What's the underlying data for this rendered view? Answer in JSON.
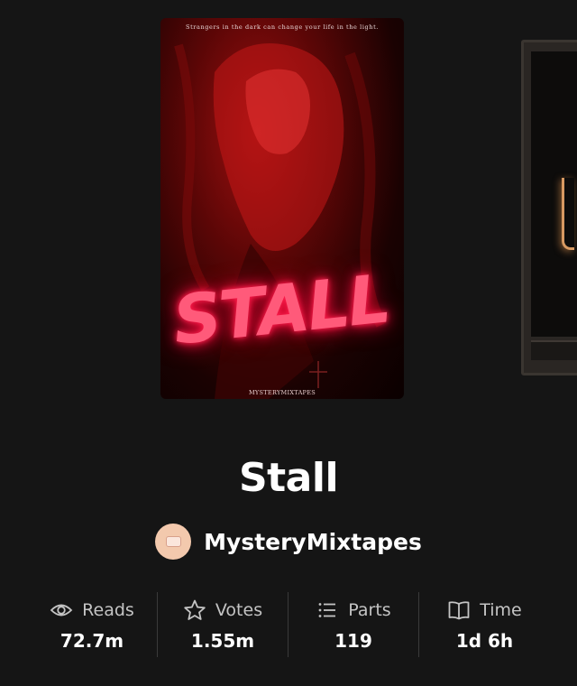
{
  "story": {
    "cover": {
      "tagline": "Strangers in the dark can change your life in the light.",
      "title_art": "STALL",
      "credit": "MYSTERYMIXTAPES"
    },
    "title": "Stall",
    "author": "MysteryMixtapes"
  },
  "stats": [
    {
      "icon": "eye-icon",
      "label": "Reads",
      "value": "72.7m"
    },
    {
      "icon": "star-icon",
      "label": "Votes",
      "value": "1.55m"
    },
    {
      "icon": "list-icon",
      "label": "Parts",
      "value": "119"
    },
    {
      "icon": "book-icon",
      "label": "Time",
      "value": "1d 6h"
    }
  ],
  "colors": {
    "background": "#151515",
    "neon_pink": "#ff5a7a",
    "cover_red": "#a01010",
    "muted_text": "#c4c4c4"
  }
}
